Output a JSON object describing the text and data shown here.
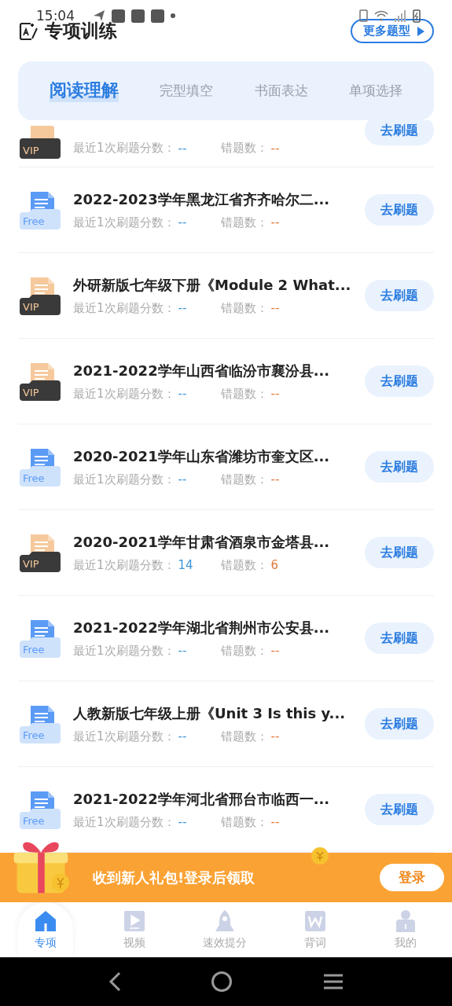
{
  "status_bar": {
    "time": "15:04"
  },
  "header": {
    "title": "专项训练",
    "more_button": "更多题型"
  },
  "tabs": [
    {
      "label": "阅读理解",
      "selected": true
    },
    {
      "label": "完型填空",
      "selected": false
    },
    {
      "label": "书面表达",
      "selected": false
    },
    {
      "label": "单项选择",
      "selected": false
    }
  ],
  "partial_row": {
    "badge": {
      "kind": "vip",
      "label": "VIP"
    },
    "score_label": "最近1次刷题分数：",
    "score": "--",
    "errors_label": "错题数：",
    "errors": "--",
    "button": "去刷题"
  },
  "rows": [
    {
      "badge": {
        "kind": "free",
        "label": "Free"
      },
      "title": "2022-2023学年黑龙江省齐齐哈尔二...",
      "score_label": "最近1次刷题分数：",
      "score": "--",
      "errors_label": "错题数：",
      "errors": "--",
      "button": "去刷题"
    },
    {
      "badge": {
        "kind": "vip",
        "label": "VIP"
      },
      "title": "外研新版七年级下册《Module 2 What...",
      "score_label": "最近1次刷题分数：",
      "score": "--",
      "errors_label": "错题数：",
      "errors": "--",
      "button": "去刷题"
    },
    {
      "badge": {
        "kind": "vip",
        "label": "VIP"
      },
      "title": "2021-2022学年山西省临汾市襄汾县...",
      "score_label": "最近1次刷题分数：",
      "score": "--",
      "errors_label": "错题数：",
      "errors": "--",
      "button": "去刷题"
    },
    {
      "badge": {
        "kind": "free",
        "label": "Free"
      },
      "title": "2020-2021学年山东省潍坊市奎文区...",
      "score_label": "最近1次刷题分数：",
      "score": "--",
      "errors_label": "错题数：",
      "errors": "--",
      "button": "去刷题"
    },
    {
      "badge": {
        "kind": "vip",
        "label": "VIP"
      },
      "title": "2020-2021学年甘肃省酒泉市金塔县...",
      "score_label": "最近1次刷题分数：",
      "score": "14",
      "errors_label": "错题数：",
      "errors": "6",
      "button": "去刷题"
    },
    {
      "badge": {
        "kind": "free",
        "label": "Free"
      },
      "title": "2021-2022学年湖北省荆州市公安县...",
      "score_label": "最近1次刷题分数：",
      "score": "--",
      "errors_label": "错题数：",
      "errors": "--",
      "button": "去刷题"
    },
    {
      "badge": {
        "kind": "free",
        "label": "Free"
      },
      "title": "人教新版七年级上册《Unit 3 Is this y...",
      "score_label": "最近1次刷题分数：",
      "score": "--",
      "errors_label": "错题数：",
      "errors": "--",
      "button": "去刷题"
    },
    {
      "badge": {
        "kind": "free",
        "label": "Free"
      },
      "title": "2021-2022学年河北省邢台市临西一...",
      "score_label": "最近1次刷题分数：",
      "score": "--",
      "errors_label": "错题数：",
      "errors": "--",
      "button": "去刷题"
    }
  ],
  "banner": {
    "text": "收到新人礼包!登录后领取",
    "button": "登录"
  },
  "nav": [
    {
      "kind": "home",
      "label": "专项",
      "selected": true
    },
    {
      "kind": "video",
      "label": "视频",
      "selected": false
    },
    {
      "kind": "rocket",
      "label": "速效提分",
      "selected": false
    },
    {
      "kind": "words",
      "label": "背词",
      "selected": false
    },
    {
      "kind": "profile",
      "label": "我的",
      "selected": false
    }
  ]
}
